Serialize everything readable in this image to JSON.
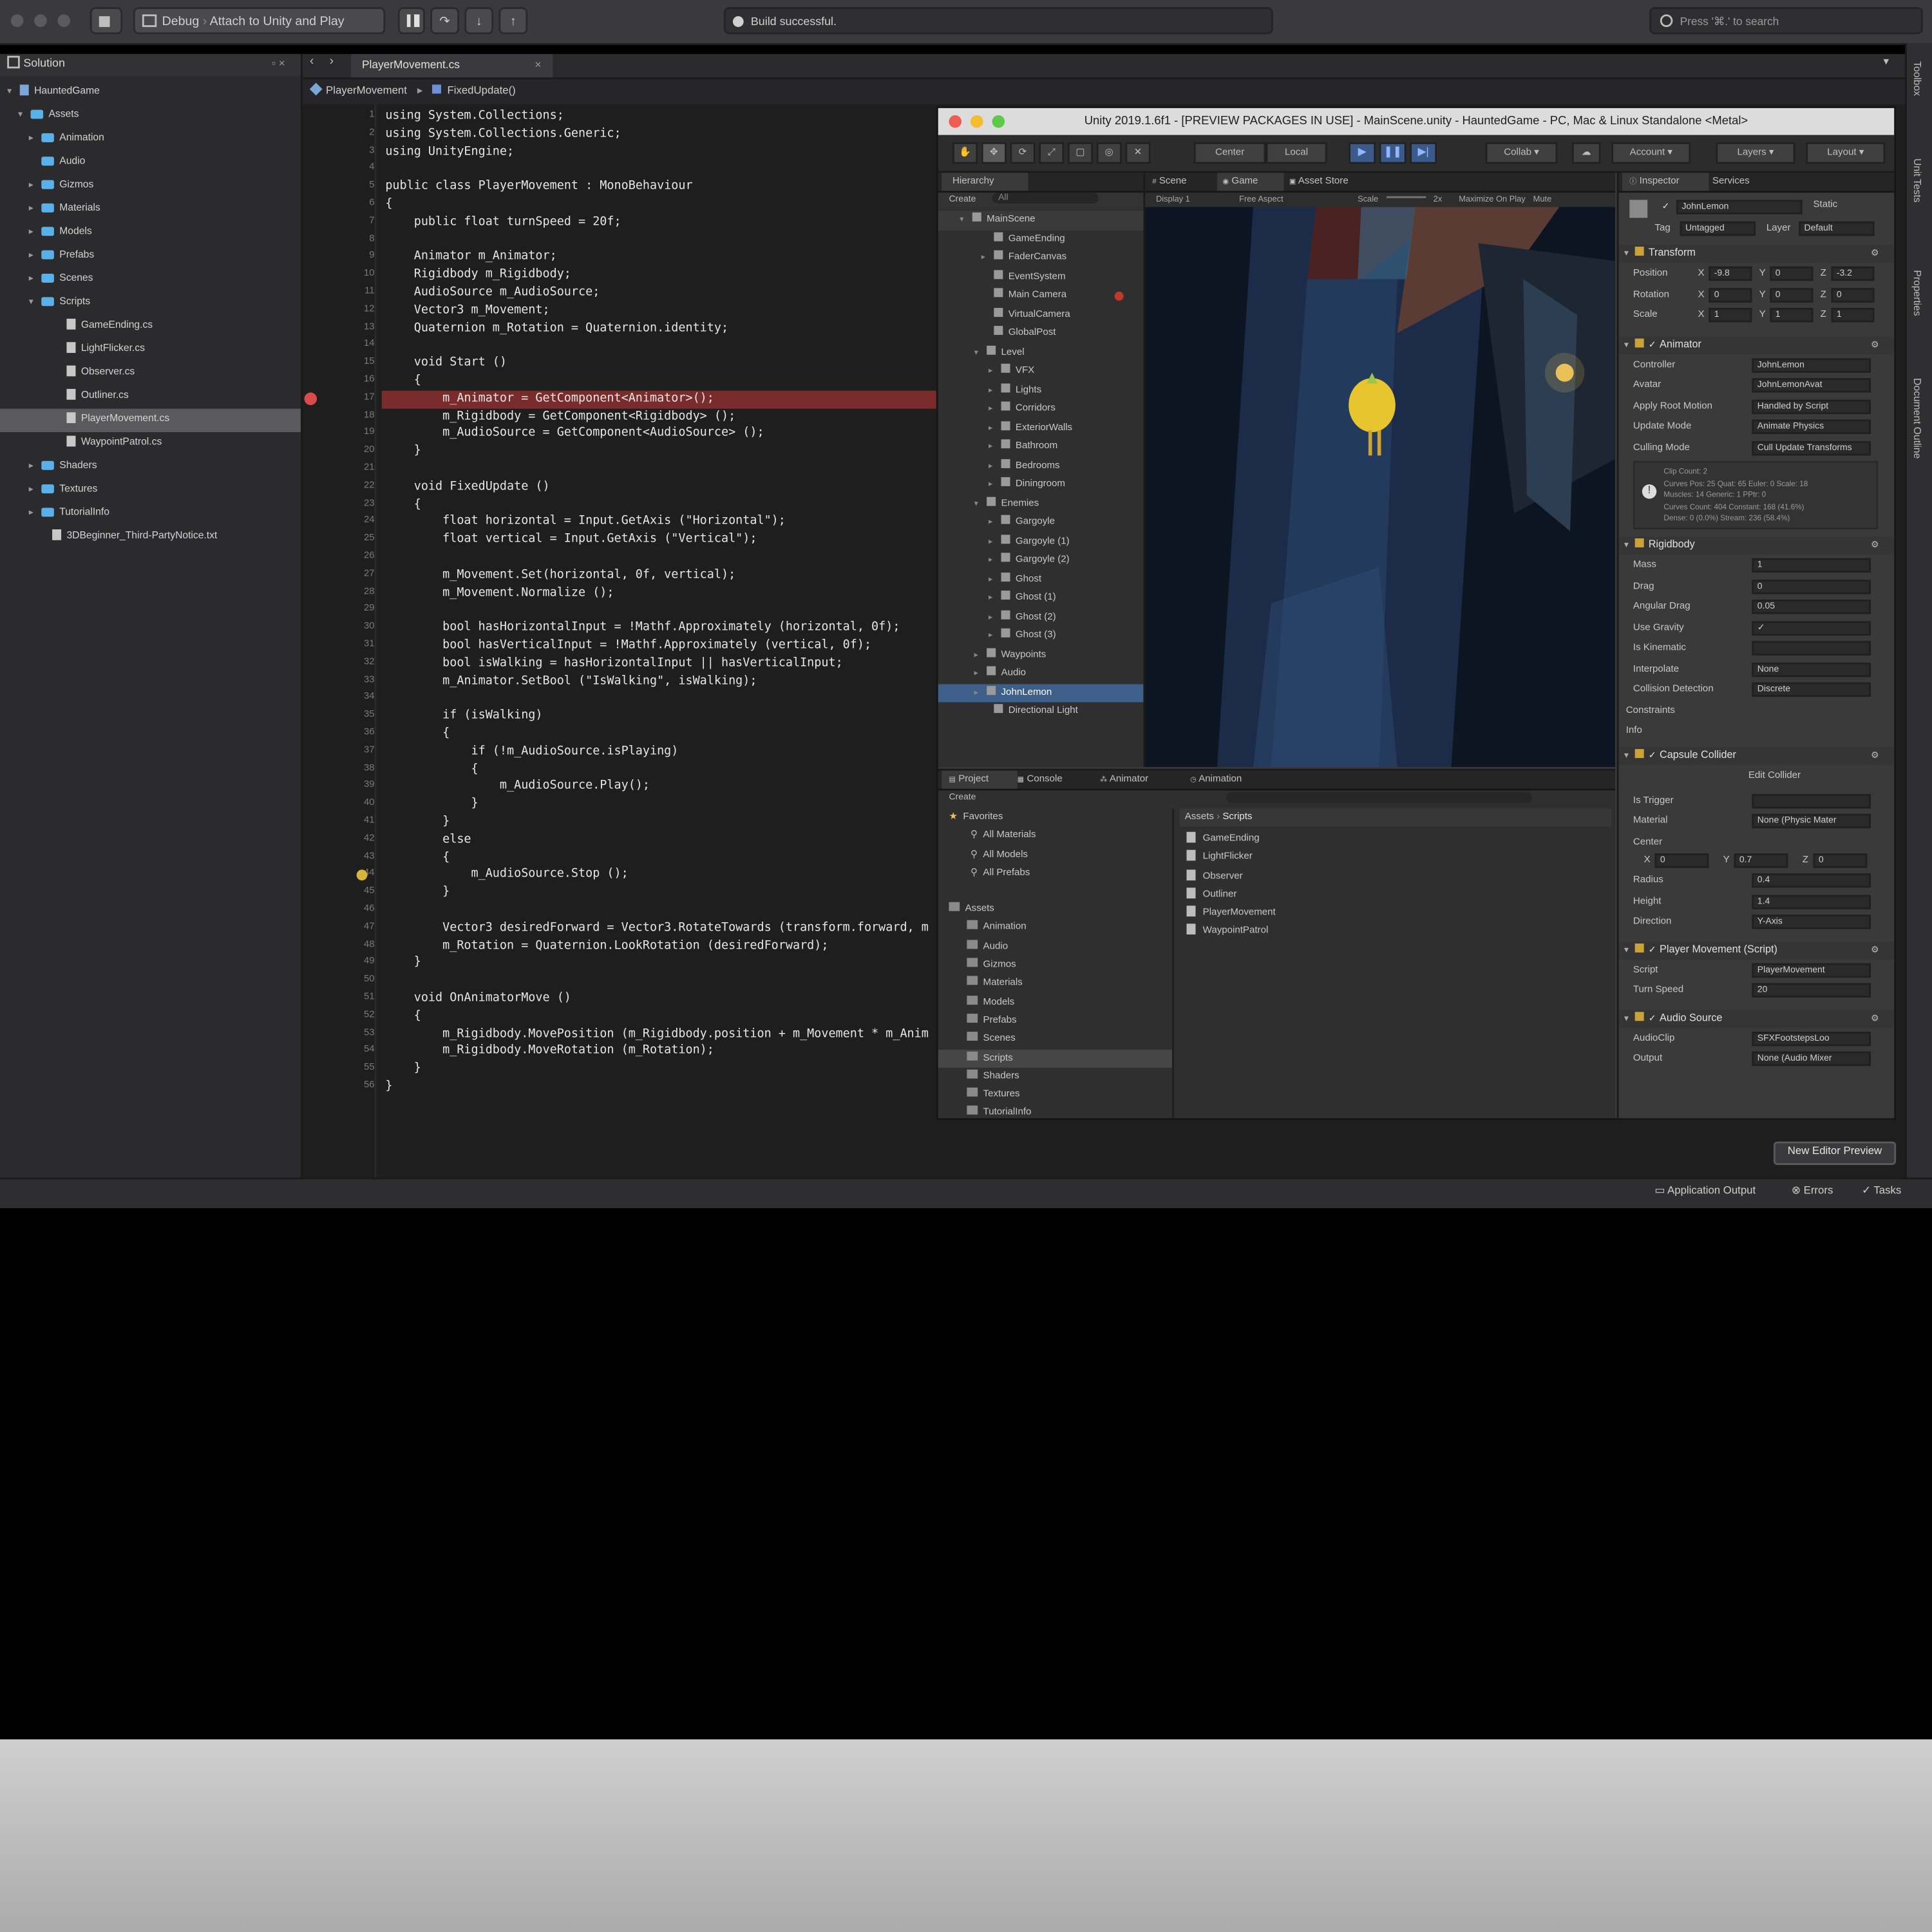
{
  "vs_toolbar": {
    "config": "Debug",
    "target": "Attach to Unity and Play",
    "build_status": "Build successful.",
    "search_placeholder": "Press '⌘.' to search"
  },
  "solution": {
    "title": "Solution",
    "items": [
      {
        "label": "HauntedGame",
        "kind": "solution"
      },
      {
        "label": "Assets",
        "kind": "folder"
      },
      {
        "label": "Animation",
        "kind": "folder"
      },
      {
        "label": "Audio",
        "kind": "folder"
      },
      {
        "label": "Gizmos",
        "kind": "folder"
      },
      {
        "label": "Materials",
        "kind": "folder"
      },
      {
        "label": "Models",
        "kind": "folder"
      },
      {
        "label": "Prefabs",
        "kind": "folder"
      },
      {
        "label": "Scenes",
        "kind": "folder"
      },
      {
        "label": "Scripts",
        "kind": "folder"
      },
      {
        "label": "GameEnding.cs",
        "kind": "file"
      },
      {
        "label": "LightFlicker.cs",
        "kind": "file"
      },
      {
        "label": "Observer.cs",
        "kind": "file"
      },
      {
        "label": "Outliner.cs",
        "kind": "file"
      },
      {
        "label": "PlayerMovement.cs",
        "kind": "file"
      },
      {
        "label": "WaypointPatrol.cs",
        "kind": "file"
      },
      {
        "label": "Shaders",
        "kind": "folder"
      },
      {
        "label": "Textures",
        "kind": "folder"
      },
      {
        "label": "TutorialInfo",
        "kind": "folder"
      },
      {
        "label": "3DBeginner_Third-PartyNotice.txt",
        "kind": "file"
      }
    ]
  },
  "editor": {
    "tab": "PlayerMovement.cs",
    "breadcrumb_class": "PlayerMovement",
    "breadcrumb_method": "FixedUpdate()",
    "line_numbers": [
      "1",
      "2",
      "3",
      "4",
      "5",
      "6",
      "7",
      "8",
      "9",
      "10",
      "11",
      "12",
      "13",
      "14",
      "15",
      "16",
      "17",
      "18",
      "19",
      "20",
      "21",
      "22",
      "23",
      "24",
      "25",
      "26",
      "27",
      "28",
      "29",
      "30",
      "31",
      "32",
      "33",
      "34",
      "35",
      "36",
      "37",
      "38",
      "39",
      "40",
      "41",
      "42",
      "43",
      "44",
      "45",
      "46",
      "47",
      "48",
      "49",
      "50",
      "51",
      "52",
      "53",
      "54",
      "55",
      "56"
    ],
    "code_lines": [
      "using System.Collections;",
      "using System.Collections.Generic;",
      "using UnityEngine;",
      "",
      "public class PlayerMovement : MonoBehaviour",
      "{",
      "    public float turnSpeed = 20f;",
      "",
      "    Animator m_Animator;",
      "    Rigidbody m_Rigidbody;",
      "    AudioSource m_AudioSource;",
      "    Vector3 m_Movement;",
      "    Quaternion m_Rotation = Quaternion.identity;",
      "",
      "    void Start ()",
      "    {",
      "        m_Animator = GetComponent<Animator>();",
      "        m_Rigidbody = GetComponent<Rigidbody> ();",
      "        m_AudioSource = GetComponent<AudioSource> ();",
      "    }",
      "",
      "    void FixedUpdate ()",
      "    {",
      "        float horizontal = Input.GetAxis (\"Horizontal\");",
      "        float vertical = Input.GetAxis (\"Vertical\");",
      "",
      "        m_Movement.Set(horizontal, 0f, vertical);",
      "        m_Movement.Normalize ();",
      "",
      "        bool hasHorizontalInput = !Mathf.Approximately (horizontal, 0f);",
      "        bool hasVerticalInput = !Mathf.Approximately (vertical, 0f);",
      "        bool isWalking = hasHorizontalInput || hasVerticalInput;",
      "        m_Animator.SetBool (\"IsWalking\", isWalking);",
      "",
      "        if (isWalking)",
      "        {",
      "            if (!m_AudioSource.isPlaying)",
      "            {",
      "                m_AudioSource.Play();",
      "            }",
      "        }",
      "        else",
      "        {",
      "            m_AudioSource.Stop ();",
      "        }",
      "",
      "        Vector3 desiredForward = Vector3.RotateTowards (transform.forward, m",
      "        m_Rotation = Quaternion.LookRotation (desiredForward);",
      "    }",
      "",
      "    void OnAnimatorMove ()",
      "    {",
      "        m_Rigidbody.MovePosition (m_Rigidbody.position + m_Movement * m_Anim",
      "        m_Rigidbody.MoveRotation (m_Rotation);",
      "    }",
      "}"
    ]
  },
  "rail": {
    "items": [
      "Toolbox",
      "Unit Tests",
      "Properties",
      "Document Outline"
    ]
  },
  "statusbar": {
    "app_output": "Application Output",
    "errors": "Errors",
    "tasks": "Tasks",
    "new_editor_preview": "New Editor Preview"
  },
  "unity": {
    "title": "Unity 2019.1.6f1 - [PREVIEW PACKAGES IN USE] - MainScene.unity - HauntedGame - PC, Mac & Linux Standalone <Metal>",
    "toolbar": {
      "center": "Center",
      "local": "Local",
      "collab": "Collab",
      "account": "Account",
      "layers": "Layers",
      "layout": "Layout"
    },
    "hierarchy": {
      "tab": "Hierarchy",
      "create": "Create",
      "search": "All",
      "rows": [
        "MainScene",
        "GameEnding",
        "FaderCanvas",
        "EventSystem",
        "Main Camera",
        "VirtualCamera",
        "GlobalPost",
        "Level",
        "VFX",
        "Lights",
        "Corridors",
        "ExteriorWalls",
        "Bathroom",
        "Bedrooms",
        "Diningroom",
        "Enemies",
        "Gargoyle",
        "Gargoyle (1)",
        "Gargoyle (2)",
        "Ghost",
        "Ghost (1)",
        "Ghost (2)",
        "Ghost (3)",
        "Waypoints",
        "Audio",
        "JohnLemon",
        "Directional Light"
      ]
    },
    "game_view": {
      "tabs": [
        "Scene",
        "Game",
        "Asset Store"
      ],
      "display": "Display 1",
      "aspect": "Free Aspect",
      "scale_label": "Scale",
      "scale_value": "2x",
      "maximize": "Maximize On Play",
      "mute": "Mute"
    },
    "project": {
      "tabs": [
        "Project",
        "Console",
        "Animator",
        "Animation"
      ],
      "create": "Create",
      "favorites": "Favorites",
      "favorite_items": [
        "All Materials",
        "All Models",
        "All Prefabs"
      ],
      "assets_root": "Assets",
      "asset_folders": [
        "Animation",
        "Audio",
        "Gizmos",
        "Materials",
        "Models",
        "Prefabs",
        "Scenes",
        "Scripts",
        "Shaders",
        "Textures",
        "TutorialInfo"
      ],
      "path": [
        "Assets",
        "Scripts"
      ],
      "scripts": [
        "GameEnding",
        "LightFlicker",
        "Observer",
        "Outliner",
        "PlayerMovement",
        "WaypointPatrol"
      ]
    },
    "inspector": {
      "tabs": [
        "Inspector",
        "Services"
      ],
      "object_name": "JohnLemon",
      "static": "Static",
      "tag_label": "Tag",
      "tag": "Untagged",
      "layer_label": "Layer",
      "layer": "Default",
      "transform": {
        "title": "Transform",
        "position": [
          "Position",
          "X",
          "-9.8",
          "Y",
          "0",
          "Z",
          "-3.2"
        ],
        "rotation": [
          "Rotation",
          "X",
          "0",
          "Y",
          "0",
          "Z",
          "0"
        ],
        "scale": [
          "Scale",
          "X",
          "1",
          "Y",
          "1",
          "Z",
          "1"
        ]
      },
      "animator": {
        "title": "Animator",
        "fields": [
          [
            "Controller",
            "JohnLemon"
          ],
          [
            "Avatar",
            "JohnLemonAvat"
          ],
          [
            "Apply Root Motion",
            "Handled by Script"
          ],
          [
            "Update Mode",
            "Animate Physics"
          ],
          [
            "Culling Mode",
            "Cull Update Transforms"
          ]
        ],
        "info": [
          "Clip Count: 2",
          "Curves Pos: 25 Quat: 65 Euler: 0 Scale: 18",
          "Muscles: 14 Generic: 1 PPtr: 0",
          "Curves Count: 404 Constant: 168 (41.6%)",
          "Dense: 0 (0.0%) Stream: 236 (58.4%)"
        ]
      },
      "rigidbody": {
        "title": "Rigidbody",
        "fields": [
          [
            "Mass",
            "1"
          ],
          [
            "Drag",
            "0"
          ],
          [
            "Angular Drag",
            "0.05"
          ],
          [
            "Use Gravity",
            "✓"
          ],
          [
            "Is Kinematic",
            ""
          ],
          [
            "Interpolate",
            "None"
          ],
          [
            "Collision Detection",
            "Discrete"
          ]
        ],
        "constraints": "Constraints",
        "info": "Info"
      },
      "capsule": {
        "title": "Capsule Collider",
        "edit": "Edit Collider",
        "fields": [
          [
            "Is Trigger",
            ""
          ],
          [
            "Material",
            "None (Physic Mater"
          ]
        ],
        "center": [
          "Center",
          "X",
          "0",
          "Y",
          "0.7",
          "Z",
          "0"
        ],
        "fields2": [
          [
            "Radius",
            "0.4"
          ],
          [
            "Height",
            "1.4"
          ],
          [
            "Direction",
            "Y-Axis"
          ]
        ]
      },
      "player_movement": {
        "title": "Player Movement (Script)",
        "fields": [
          [
            "Script",
            "PlayerMovement"
          ],
          [
            "Turn Speed",
            "20"
          ]
        ]
      },
      "audio_source": {
        "title": "Audio Source",
        "fields": [
          [
            "AudioClip",
            "SFXFootstepsLoo"
          ],
          [
            "Output",
            "None (Audio Mixer"
          ]
        ]
      }
    }
  }
}
